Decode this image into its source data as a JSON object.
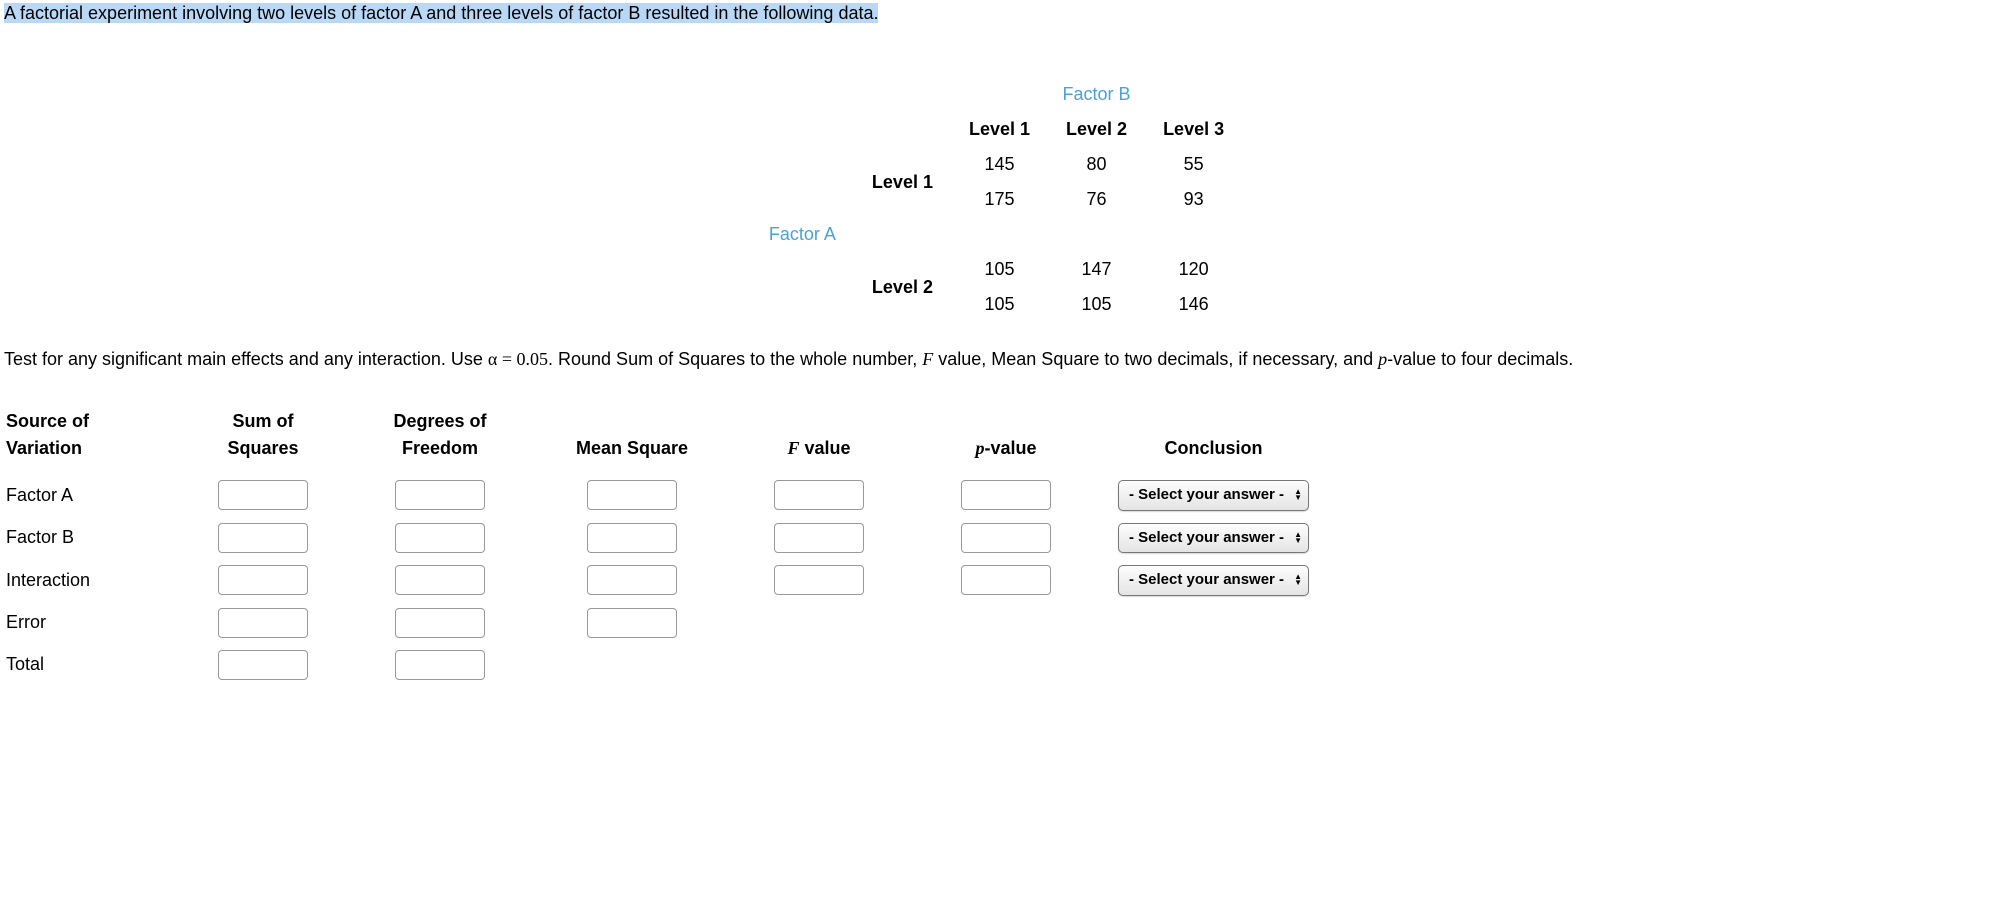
{
  "intro": "A factorial experiment involving two levels of factor A and three levels of factor B resulted in the following data.",
  "factorB_label": "Factor B",
  "factorA_label": "Factor A",
  "col_headers": {
    "l1": "Level 1",
    "l2": "Level 2",
    "l3": "Level 3"
  },
  "row_headers": {
    "l1": "Level 1",
    "l2": "Level 2"
  },
  "data": {
    "a1": {
      "r1": {
        "b1": "145",
        "b2": "80",
        "b3": "55"
      },
      "r2": {
        "b1": "175",
        "b2": "76",
        "b3": "93"
      }
    },
    "a2": {
      "r1": {
        "b1": "105",
        "b2": "147",
        "b3": "120"
      },
      "r2": {
        "b1": "105",
        "b2": "105",
        "b3": "146"
      }
    }
  },
  "instructions": {
    "p1": "Test for any significant main effects and any interaction. Use ",
    "alpha_expr": "α = 0.05",
    "p2": ". Round Sum of Squares to the whole number, ",
    "F_sym": "F",
    "p3": " value, Mean Square to two decimals, if necessary, and ",
    "p_sym": "p",
    "p4": "-value to four decimals."
  },
  "anova": {
    "headers": {
      "source1": "Source of",
      "source2": "Variation",
      "ss1": "Sum of",
      "ss2": "Squares",
      "df1": "Degrees of",
      "df2": "Freedom",
      "ms": "Mean Square",
      "f_pre": "F",
      "f_post": " value",
      "p_pre": "p",
      "p_post": "-value",
      "conclusion": "Conclusion"
    },
    "rows": {
      "factorA": "Factor A",
      "factorB": "Factor B",
      "interaction": "Interaction",
      "error": "Error",
      "total": "Total"
    },
    "select_placeholder": "- Select your answer -"
  }
}
